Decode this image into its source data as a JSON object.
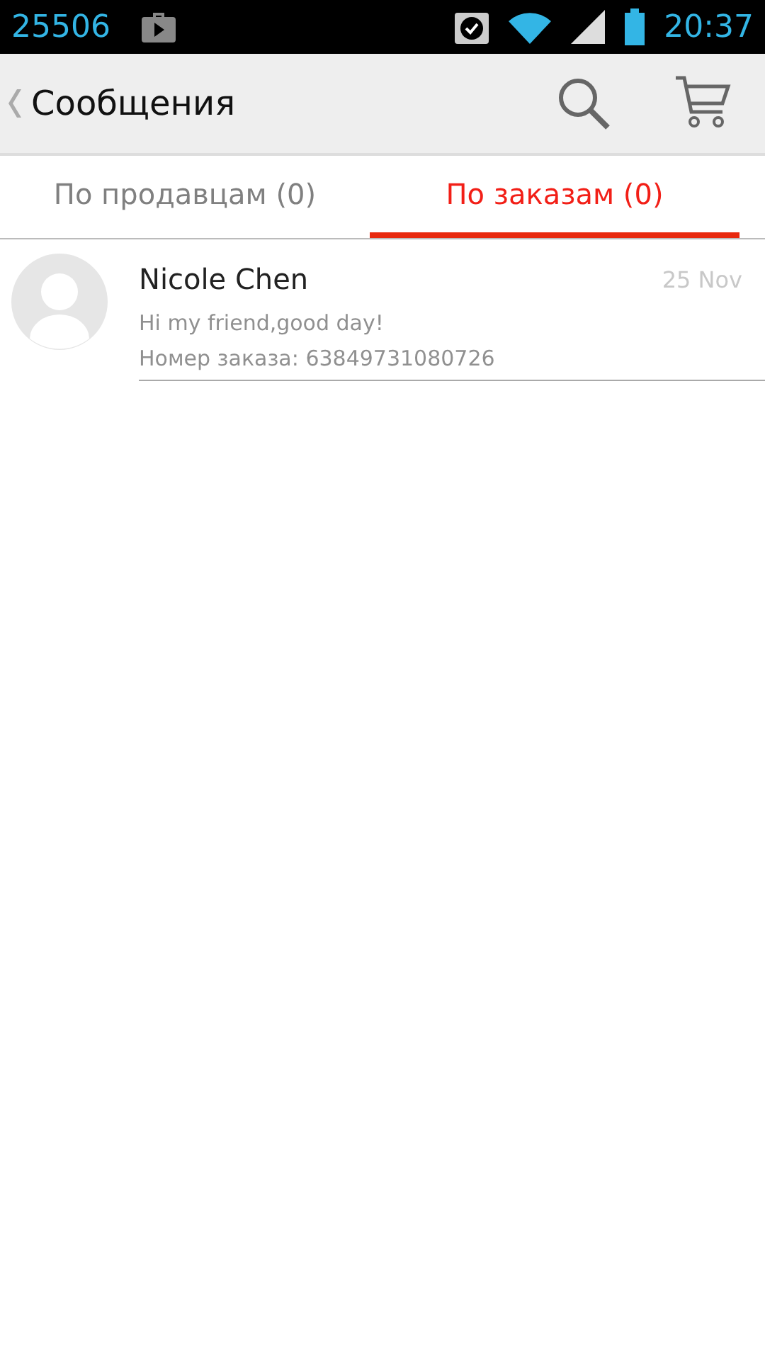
{
  "status_bar": {
    "notification": "25506",
    "time": "20:37"
  },
  "toolbar": {
    "title": "Сообщения"
  },
  "tabs": [
    {
      "label": "По продавцам (0)",
      "selected": false
    },
    {
      "label": "По заказам (0)",
      "selected": true
    }
  ],
  "messages": [
    {
      "sender": "Nicole Chen",
      "date": "25 Nov",
      "text": "Hi my friend,good day!",
      "order": "Номер заказа: 63849731080726"
    }
  ]
}
